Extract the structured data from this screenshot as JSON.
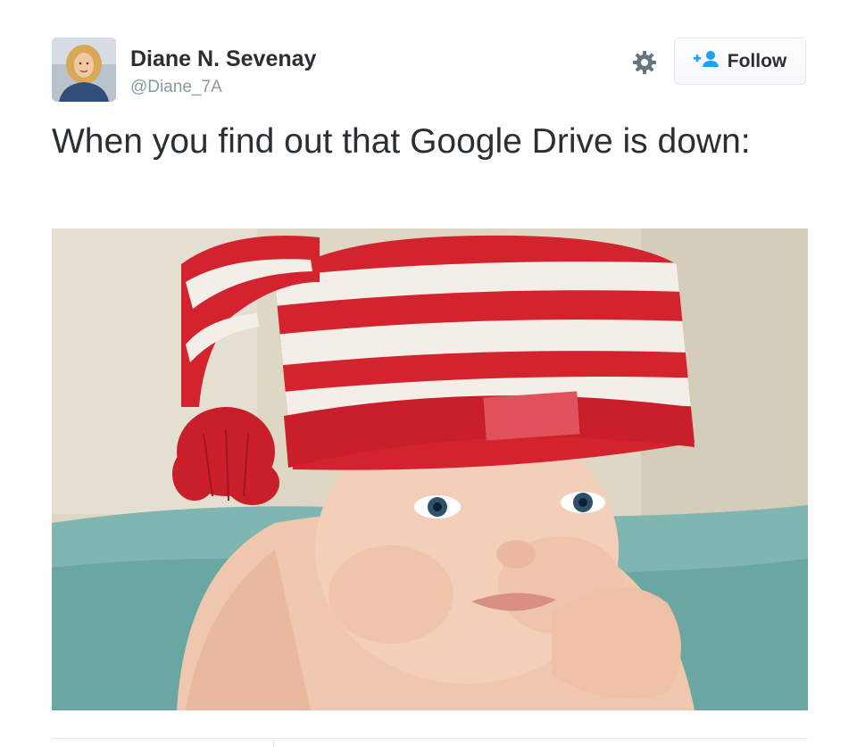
{
  "user": {
    "display_name": "Diane N. Sevenay",
    "handle": "@Diane_7A",
    "avatar_icon": "profile-photo"
  },
  "actions": {
    "settings_icon": "gear-icon",
    "follow_icon": "add-user-icon",
    "follow_label": "Follow"
  },
  "tweet": {
    "text": "When you find out that Google Drive is down:"
  },
  "media": {
    "image_label": "Photo of a pouting baby wearing a red and white striped knit hat"
  },
  "colors": {
    "text": "#292f33",
    "muted": "#8899a6",
    "accent": "#1da1f2",
    "border": "#e1e8ed"
  }
}
